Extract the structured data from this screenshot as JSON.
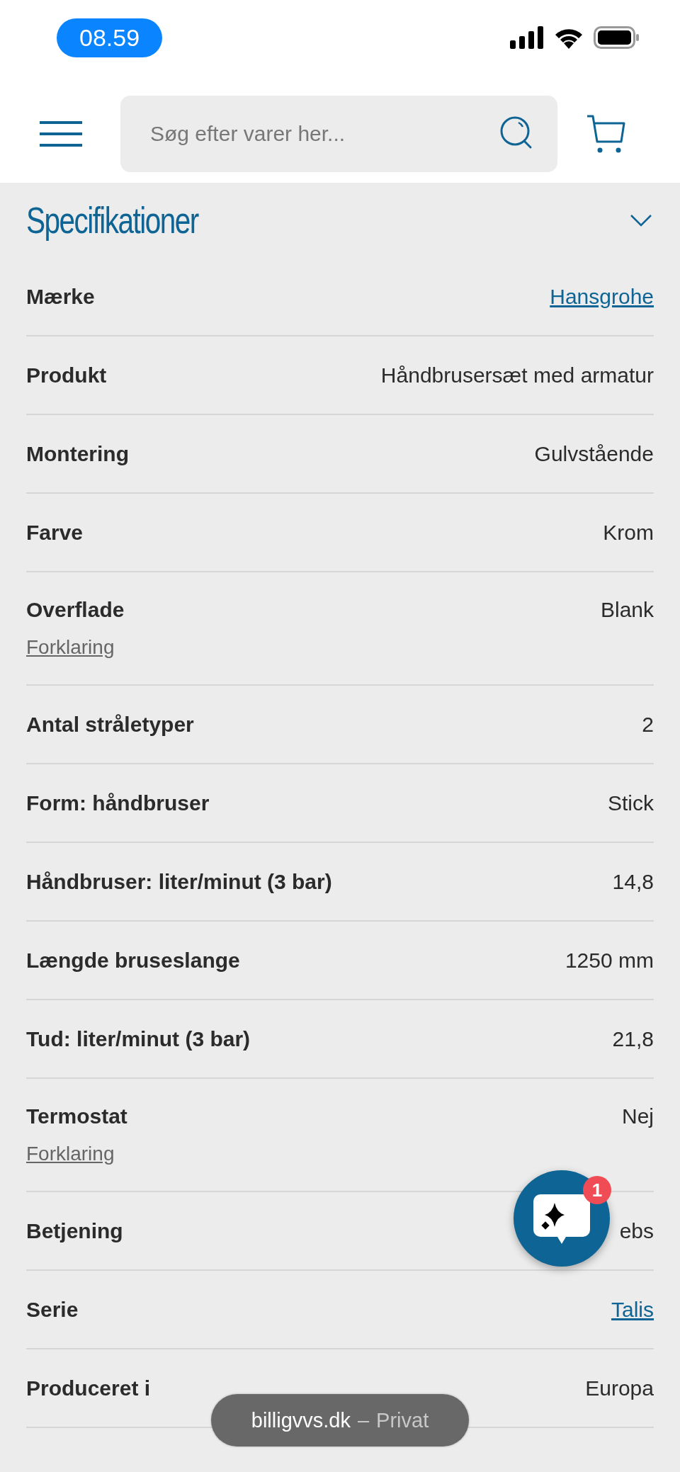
{
  "status_bar": {
    "time": "08.59"
  },
  "header": {
    "search": {
      "placeholder": "Søg efter varer her..."
    }
  },
  "specifications": {
    "title": "Specifikationer",
    "expanded": true,
    "rows": [
      {
        "label": "Mærke",
        "value": "Hansgrohe",
        "kind": "link"
      },
      {
        "label": "Produkt",
        "value": "Håndbrusersæt med armatur",
        "kind": "text"
      },
      {
        "label": "Montering",
        "value": "Gulvstående",
        "kind": "text"
      },
      {
        "label": "Farve",
        "value": "Krom",
        "kind": "text"
      },
      {
        "label": "Overflade",
        "value": "Blank",
        "kind": "text",
        "explain": "Forklaring"
      },
      {
        "label": "Antal stråletyper",
        "value": "2",
        "kind": "text"
      },
      {
        "label": "Form: håndbruser",
        "value": "Stick",
        "kind": "text"
      },
      {
        "label": "Håndbruser: liter/minut (3 bar)",
        "value": "14,8",
        "kind": "text"
      },
      {
        "label": "Længde bruseslange",
        "value": "1250 mm",
        "kind": "text"
      },
      {
        "label": "Tud: liter/minut (3 bar)",
        "value": "21,8",
        "kind": "text"
      },
      {
        "label": "Termostat",
        "value": "Nej",
        "kind": "text",
        "explain": "Forklaring"
      },
      {
        "label": "Betjening",
        "value": "ebs",
        "kind": "text"
      },
      {
        "label": "Serie",
        "value": "Talis",
        "kind": "link"
      },
      {
        "label": "Produceret i",
        "value": "Europa",
        "kind": "text"
      }
    ]
  },
  "chat_button": {
    "badge": "1"
  },
  "url_pill": {
    "domain": "billigvvs.dk",
    "separator": "–",
    "mode": "Privat"
  }
}
